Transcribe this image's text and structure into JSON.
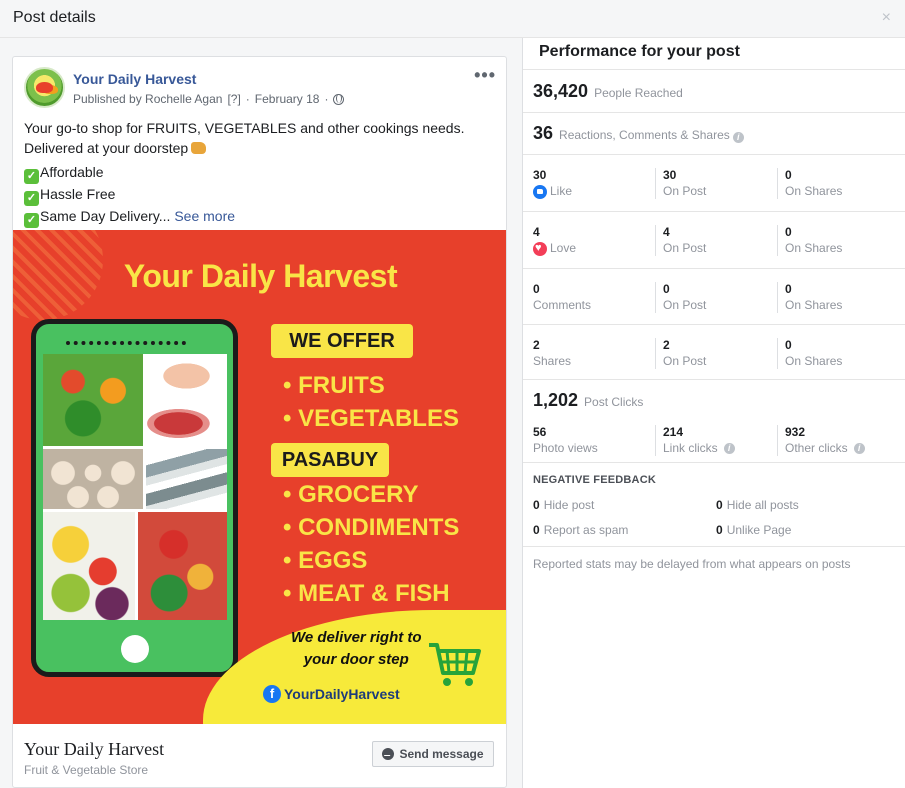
{
  "dialog": {
    "title": "Post details",
    "close": "×"
  },
  "post": {
    "page_name": "Your Daily Harvest",
    "published_by": "Published by Rochelle Agan",
    "help_marker": "[?]",
    "date": "February 18",
    "separator": "·",
    "more": "•••",
    "text_line1": "Your go-to shop for FRUITS, VEGETABLES and other cookings needs.",
    "text_line2": "Delivered at your doorstep",
    "check_glyph": "✓",
    "bullet1": "Affordable",
    "bullet2": "Hassle Free",
    "bullet3": "Same Day Delivery...",
    "see_more": "See more",
    "image": {
      "title": "Your Daily Harvest",
      "we_offer": "WE OFFER",
      "offer_items": [
        "• FRUITS",
        "• VEGETABLES"
      ],
      "pasabuy": "PASABUY",
      "pasabuy_items": [
        "• GROCERY",
        "• CONDIMENTS",
        "• EGGS",
        "• MEAT & FISH"
      ],
      "deliver_line1": "We deliver right to",
      "deliver_line2": "your door step",
      "fb_glyph": "f",
      "handle": "YourDailyHarvest",
      "colors": {
        "background": "#e7402b",
        "accent": "#f9e547",
        "phone": "#49c160"
      }
    },
    "footer_name": "Your Daily Harvest",
    "footer_category": "Fruit & Vegetable Store",
    "send_message": "Send message"
  },
  "performance": {
    "title": "Performance for your post",
    "people_reached": {
      "value": "36,420",
      "label": "People Reached"
    },
    "engagement": {
      "value": "36",
      "label": "Reactions, Comments & Shares"
    },
    "info_glyph": "i",
    "rows": [
      {
        "a_num": "30",
        "a_label": "Like",
        "b_num": "30",
        "b_label": "On Post",
        "c_num": "0",
        "c_label": "On Shares"
      },
      {
        "a_num": "4",
        "a_label": "Love",
        "b_num": "4",
        "b_label": "On Post",
        "c_num": "0",
        "c_label": "On Shares"
      },
      {
        "a_num": "0",
        "a_label": "Comments",
        "b_num": "0",
        "b_label": "On Post",
        "c_num": "0",
        "c_label": "On Shares"
      },
      {
        "a_num": "2",
        "a_label": "Shares",
        "b_num": "2",
        "b_label": "On Post",
        "c_num": "0",
        "c_label": "On Shares"
      }
    ],
    "post_clicks": {
      "value": "1,202",
      "label": "Post Clicks"
    },
    "clicks": [
      {
        "num": "56",
        "label": "Photo views"
      },
      {
        "num": "214",
        "label": "Link clicks"
      },
      {
        "num": "932",
        "label": "Other clicks"
      }
    ],
    "negative_feedback": {
      "title": "NEGATIVE FEEDBACK",
      "hide_post": {
        "num": "0",
        "label": "Hide post"
      },
      "hide_all": {
        "num": "0",
        "label": "Hide all posts"
      },
      "spam": {
        "num": "0",
        "label": "Report as spam"
      },
      "unlike": {
        "num": "0",
        "label": "Unlike Page"
      }
    },
    "note": "Reported stats may be delayed from what appears on posts"
  }
}
